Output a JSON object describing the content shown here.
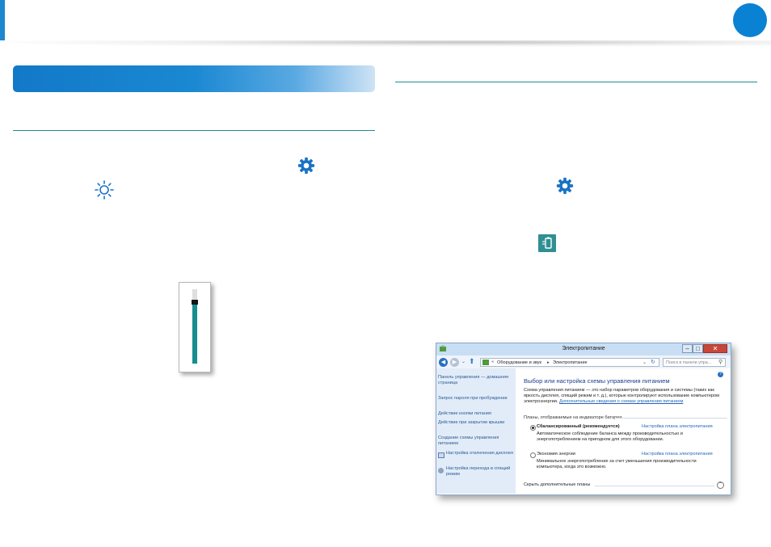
{
  "brightness": {
    "level_fraction": 0.82
  },
  "window": {
    "title": "Электропитание",
    "buttons": {
      "minimize": "–",
      "maximize": "□",
      "close": "✕"
    },
    "address": {
      "crumb_1": "Оборудование и звук",
      "separator": "▸",
      "crumb_2": "Электропитание"
    },
    "search_placeholder": "Поиск в панели упра...",
    "help": "?",
    "sidebar": {
      "items": [
        "Панель управления — домашняя страница",
        "Запрос пароля при пробуждении",
        "Действие кнопки питания",
        "Действие при закрытии крышки",
        "Создание схемы управления питанием",
        "Настройка отключения дисплея",
        "Настройка перехода в спящий режим"
      ]
    },
    "main": {
      "heading": "Выбор или настройка схемы управления питанием",
      "intro": "Схема управления питанием — это набор параметров оборудования и системы (таких как яркость дисплея, спящий режим и т. д.), которые контролируют использование компьютером электроэнергии.",
      "intro_link": "Дополнительные сведения о схемах управления питанием",
      "group_label": "Планы, отображаемые на индикаторе батареи",
      "plans": [
        {
          "name": "Сбалансированный (рекомендуется)",
          "link": "Настройка плана электропитания",
          "desc": "Автоматическое соблюдение баланса между производительностью и энергопотреблением на пригодном для этого оборудовании.",
          "selected": true
        },
        {
          "name": "Экономия энергии",
          "link": "Настройка плана электропитания",
          "desc": "Минимальное энергопотребление за счет уменьшения производительности компьютера, когда это возможно.",
          "selected": false
        }
      ],
      "hide_plans": "Скрыть дополнительные планы"
    }
  }
}
